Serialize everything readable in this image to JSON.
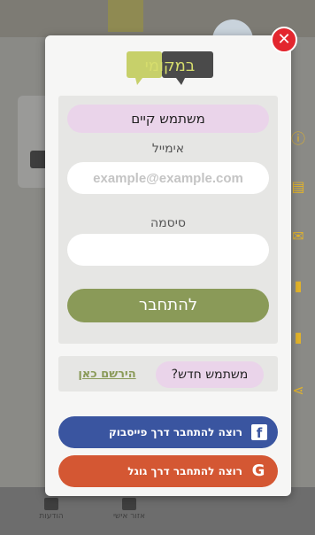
{
  "modal": {
    "logo_text": "במקומי",
    "close_label": "✕",
    "existing_user_label": "משתמש קיים",
    "email_label": "אימייל",
    "email_placeholder": "example@example.com",
    "password_label": "סיסמה",
    "login_button": "להתחבר",
    "new_user_label": "משתמש חדש?",
    "register_link": "הירשם כאן",
    "facebook_button": "רוצה להתחבר דרך פייסבוק",
    "google_button": "רוצה להתחבר דרך גוגל",
    "facebook_icon": "f",
    "google_icon": "G"
  },
  "background": {
    "bottom_tabs": [
      "הודעות",
      "אזור אישי"
    ],
    "side_icons": [
      "info-icon",
      "news-icon",
      "mail-icon",
      "document-icon",
      "contract-icon",
      "share-icon"
    ]
  },
  "colors": {
    "accent_green": "#8a9a58",
    "pill_pink": "#ead4ea",
    "facebook": "#3a55a0",
    "google": "#d45733",
    "close_red": "#e3262e"
  }
}
